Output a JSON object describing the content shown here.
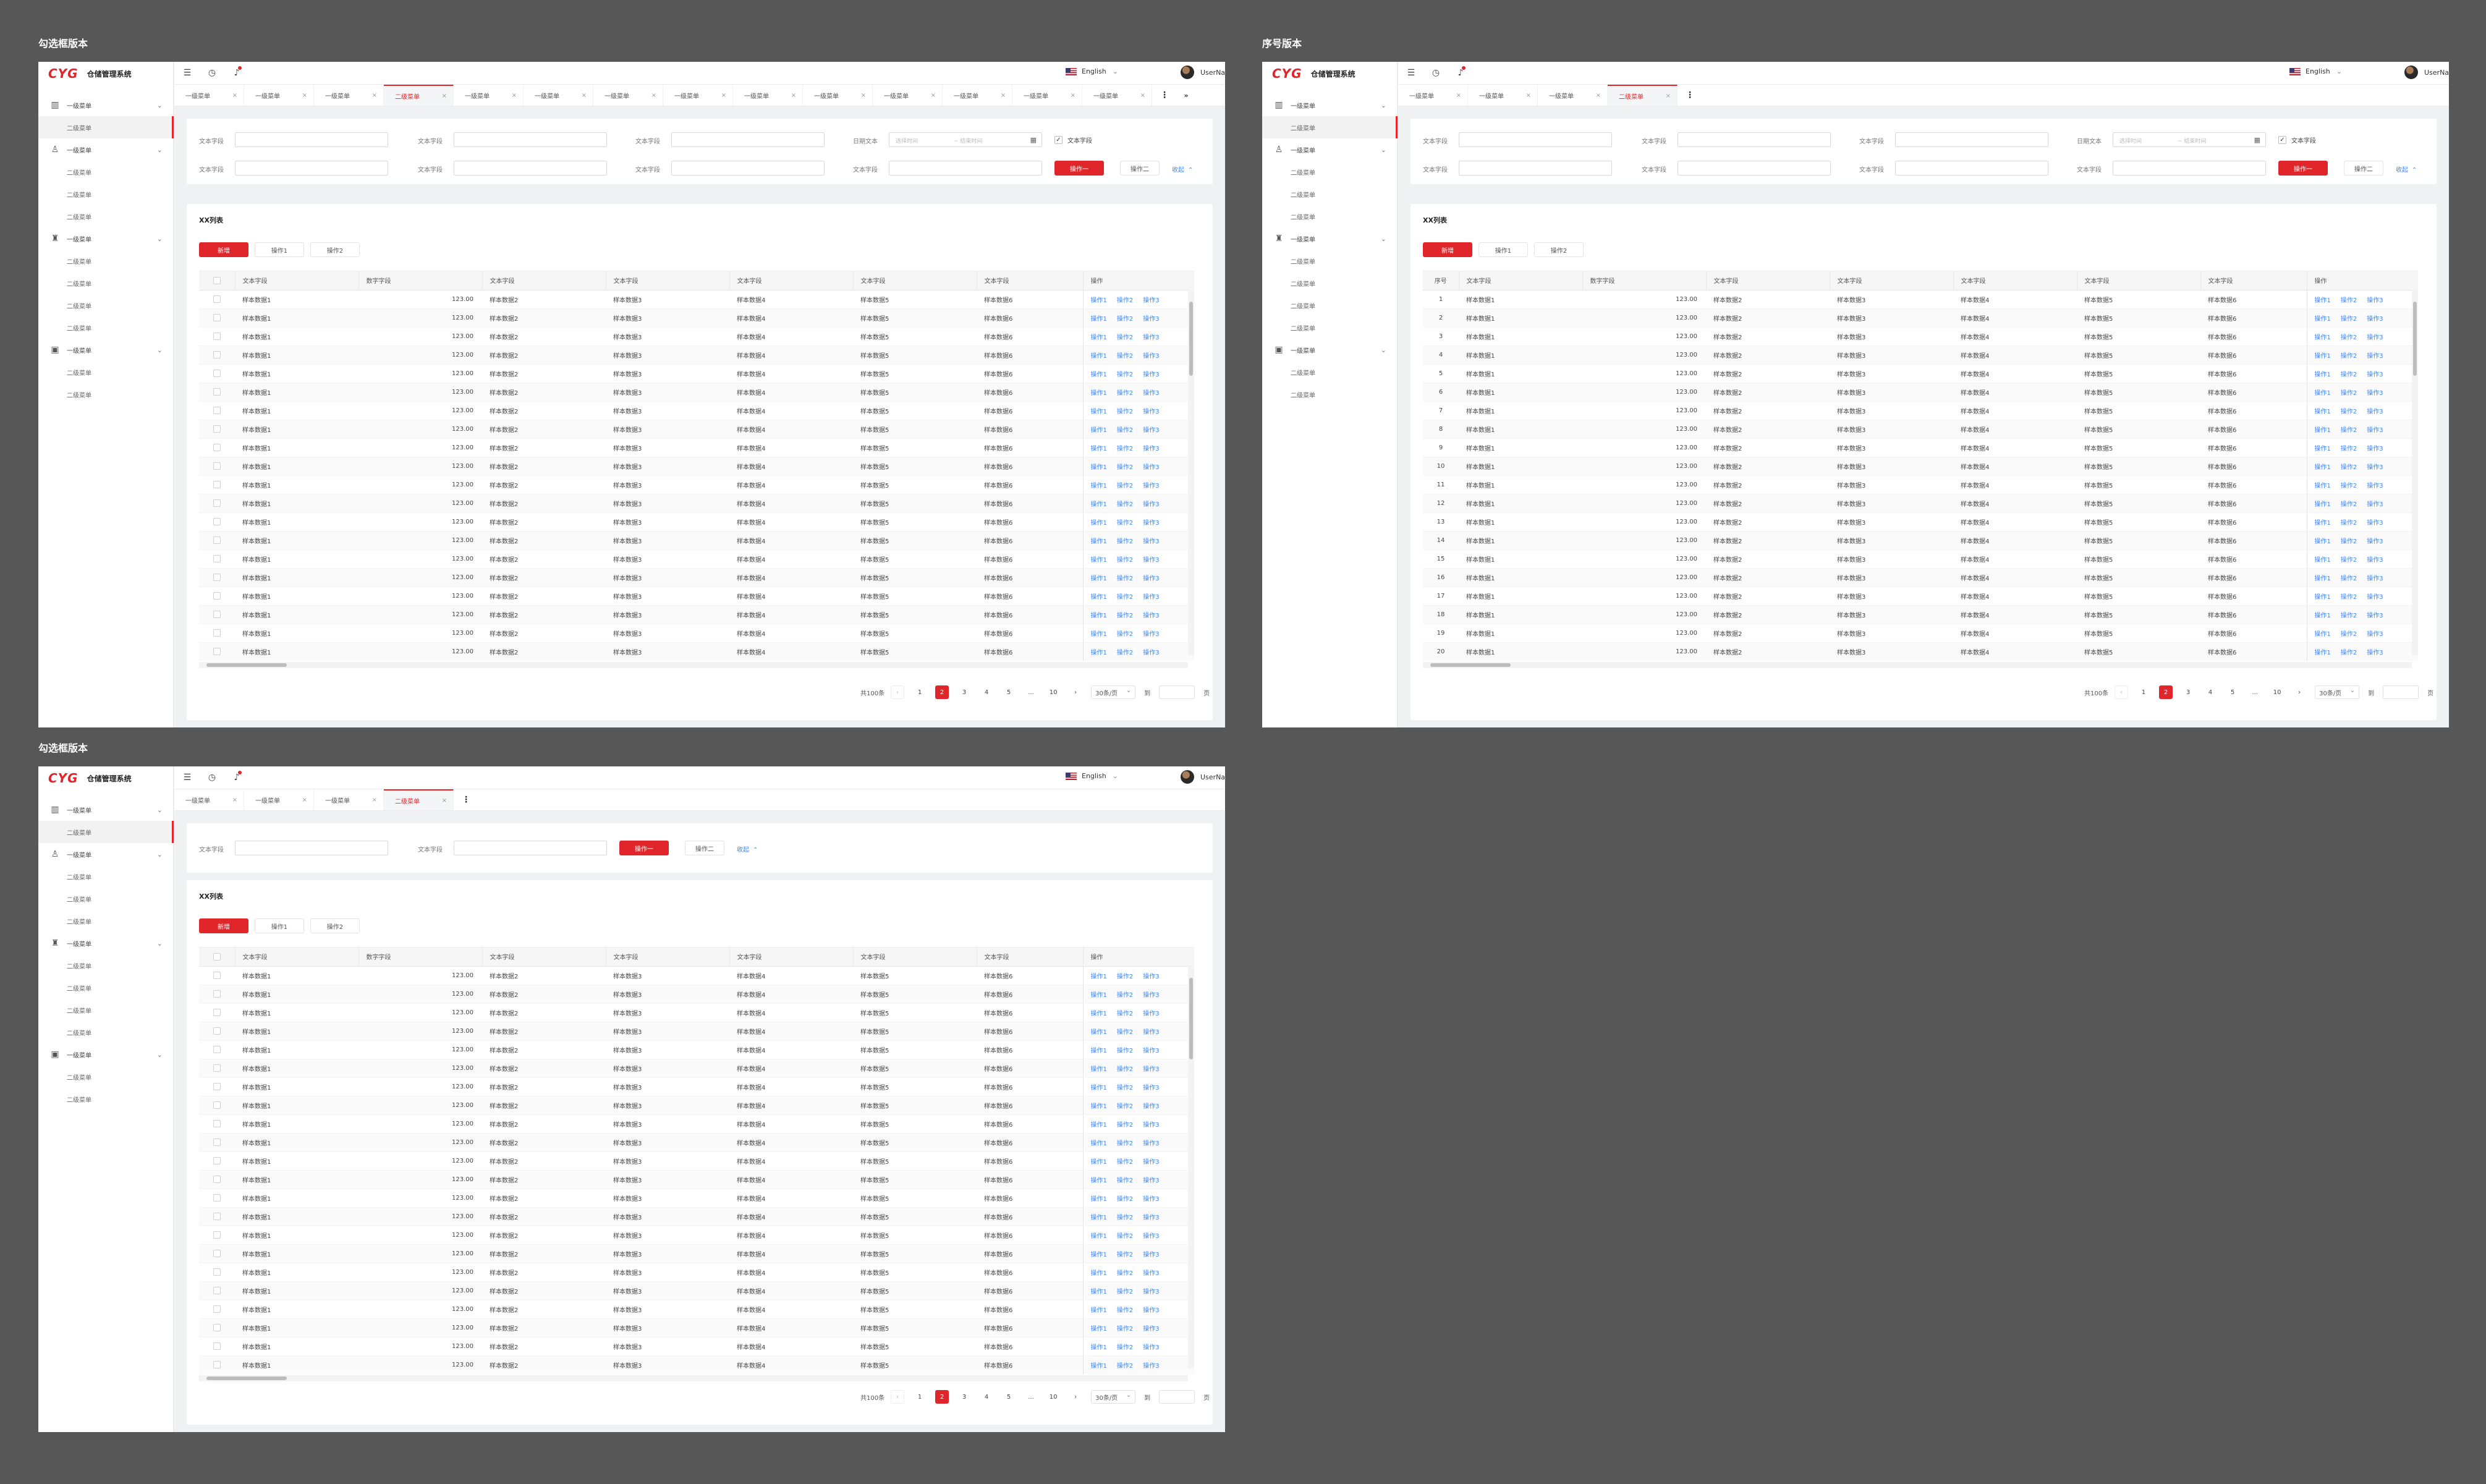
{
  "sections": {
    "a": "勾选框版本",
    "b": "序号版本",
    "c": "勾选框版本"
  },
  "colors": {
    "primary": "#e0262b",
    "link": "#3e86f6",
    "backdrop": "#575757"
  },
  "app": {
    "logo": "CYG",
    "name": "仓储管理系统"
  },
  "header": {
    "language": "English",
    "username": "UserName",
    "icons": [
      "collapse-menu-icon",
      "history-icon",
      "bell-icon"
    ]
  },
  "sidebar": [
    {
      "label": "一级菜单",
      "icon": "chart-icon",
      "children": [
        "二级菜单"
      ]
    },
    {
      "label": "一级菜单",
      "icon": "user-icon",
      "children": [
        "二级菜单",
        "二级菜单",
        "二级菜单"
      ]
    },
    {
      "label": "一级菜单",
      "icon": "org-icon",
      "children": [
        "二级菜单",
        "二级菜单",
        "二级菜单",
        "二级菜单"
      ]
    },
    {
      "label": "一级菜单",
      "icon": "monitor-icon",
      "children": [
        "二级菜单",
        "二级菜单"
      ]
    }
  ],
  "tabs": {
    "full": [
      "一级菜单",
      "一级菜单",
      "一级菜单",
      "二级菜单",
      "一级菜单",
      "一级菜单",
      "一级菜单",
      "一级菜单",
      "一级菜单",
      "一级菜单",
      "一级菜单",
      "一级菜单",
      "一级菜单",
      "一级菜单"
    ],
    "short": [
      "一级菜单",
      "一级菜单",
      "一级菜单",
      "二级菜单"
    ],
    "active_index": 3
  },
  "filters": {
    "text_label": "文本字段",
    "date_label": "日期文本",
    "start_placeholder": "选择时间",
    "sep": "~",
    "end_placeholder": "~ 结束时间",
    "checkbox_label": "文本字段",
    "btn_primary": "操作一",
    "btn_secondary": "操作二",
    "collapse": "收起"
  },
  "list": {
    "title": "XX列表",
    "btn_add": "新增",
    "btn_op1": "操作1",
    "btn_op2": "操作2"
  },
  "table": {
    "seq_header": "序号",
    "columns": [
      "文本字段",
      "数字字段",
      "文本字段",
      "文本字段",
      "文本字段",
      "文本字段",
      "文本字段"
    ],
    "op_header": "操作",
    "row": [
      "样本数据1",
      "123.00",
      "样本数据2",
      "样本数据3",
      "样本数据4",
      "样本数据5",
      "样本数据6"
    ],
    "ops": [
      "操作1",
      "操作2",
      "操作3"
    ],
    "row_count": 20,
    "row_count_tall": 22
  },
  "pagination": {
    "total": "共100条",
    "pages": [
      "1",
      "2",
      "3",
      "4",
      "5",
      "...",
      "10"
    ],
    "current": "2",
    "size": "30条/页",
    "goto": "到",
    "unit": "页",
    "prev": "‹",
    "next": "›"
  }
}
